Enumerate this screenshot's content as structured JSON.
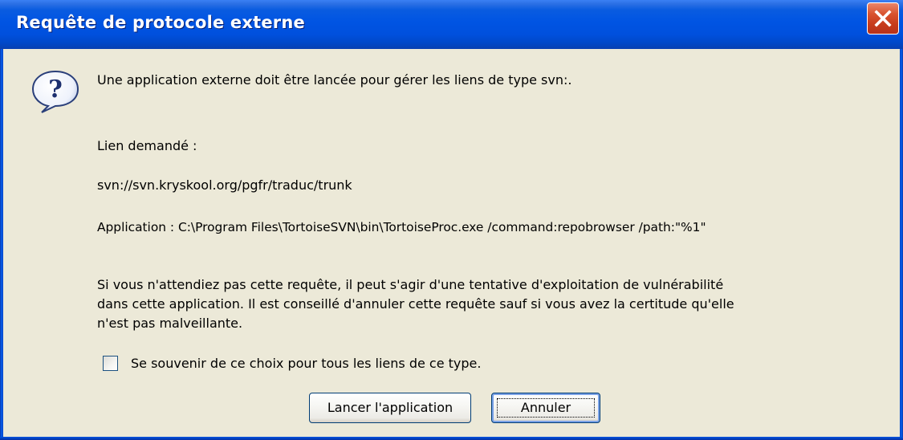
{
  "dialog": {
    "title": "Requête de protocole externe",
    "message": "Une application externe doit être lancée pour gérer les liens de type svn:.",
    "requested_link_label": "Lien demandé :",
    "requested_link": "svn://svn.kryskool.org/pgfr/traduc/trunk",
    "application_line": "Application : C:\\Program Files\\TortoiseSVN\\bin\\TortoiseProc.exe /command:repobrowser /path:\"%1\"",
    "warning_line1": "Si vous n'attendiez pas cette requête, il peut s'agir d'une tentative d'exploitation de vulnérabilité",
    "warning_line2": "dans cette application. Il est conseillé d'annuler cette requête sauf si vous avez la certitude qu'elle",
    "warning_line3": "n'est pas malveillante.",
    "remember_label": "Se souvenir de ce choix pour tous les liens de ce type.",
    "remember_checked": false,
    "launch_button": "Lancer l'application",
    "cancel_button": "Annuler"
  },
  "icons": {
    "close": "close-icon",
    "question": "question-icon"
  },
  "colors": {
    "titlebar": "#0054e3",
    "close_button": "#d9532f",
    "dialog_background": "#ece9d8"
  }
}
